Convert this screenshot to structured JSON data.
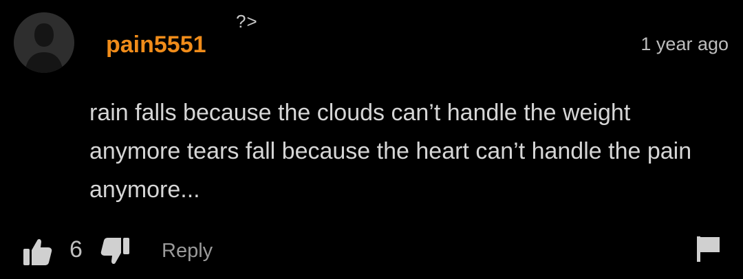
{
  "comment": {
    "tag_glyph": "?>",
    "username": "pain5551",
    "timestamp": "1 year ago",
    "body": "rain falls because the clouds can’t handle the weight anymore tears fall because the heart can’t handle the pain anymore...",
    "like_count": "6",
    "reply_label": "Reply"
  },
  "icons": {
    "avatar": "default-user-silhouette",
    "like": "thumbs-up-icon",
    "dislike": "thumbs-down-icon",
    "flag": "flag-icon"
  },
  "colors": {
    "background": "#000000",
    "username": "#f08c1a",
    "body_text": "#d6d6d6",
    "muted_text": "#9a9a9a",
    "avatar_bg": "#2e2e2e",
    "icon": "#d0d0d0"
  }
}
